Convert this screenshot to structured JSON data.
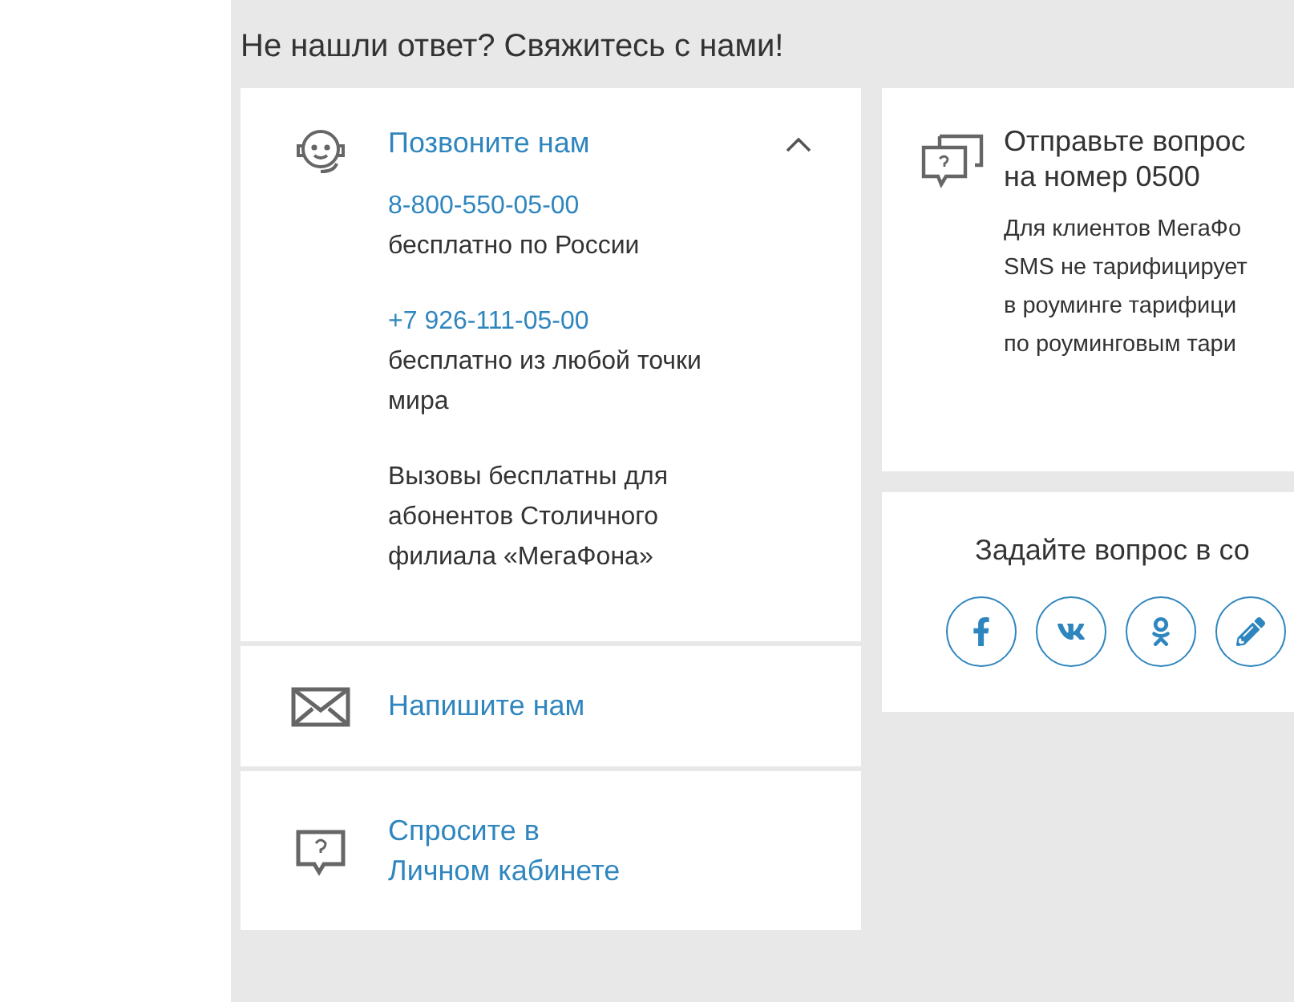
{
  "heading": "Не нашли ответ? Свяжитесь с нами!",
  "contacts": [
    {
      "kind": "call",
      "title": "Позвоните нам",
      "expanded": true,
      "phones": [
        {
          "number": "8-800-550-05-00",
          "note": "бесплатно по России"
        },
        {
          "number": "+7 926-111-05-00",
          "note": "бесплатно из любой точки мира"
        }
      ],
      "footnote": "Вызовы бесплатны для абонентов Столичного филиала «МегаФона»"
    },
    {
      "kind": "mail",
      "title": "Напишите нам",
      "expanded": false
    },
    {
      "kind": "cabinet",
      "title": "Спросите в Личном кабинете",
      "expanded": false
    }
  ],
  "sms": {
    "title_lines": [
      "Отправьте вопрос",
      "на номер 0500"
    ],
    "text_lines": [
      "Для клиентов МегаФо",
      "SMS не тарифицирует",
      "в роуминге тарифици",
      "по роуминговым тари"
    ]
  },
  "social": {
    "title": "Задайте вопрос в со",
    "networks": [
      {
        "kind": "facebook"
      },
      {
        "kind": "vk"
      },
      {
        "kind": "ok"
      },
      {
        "kind": "pencil"
      }
    ]
  }
}
